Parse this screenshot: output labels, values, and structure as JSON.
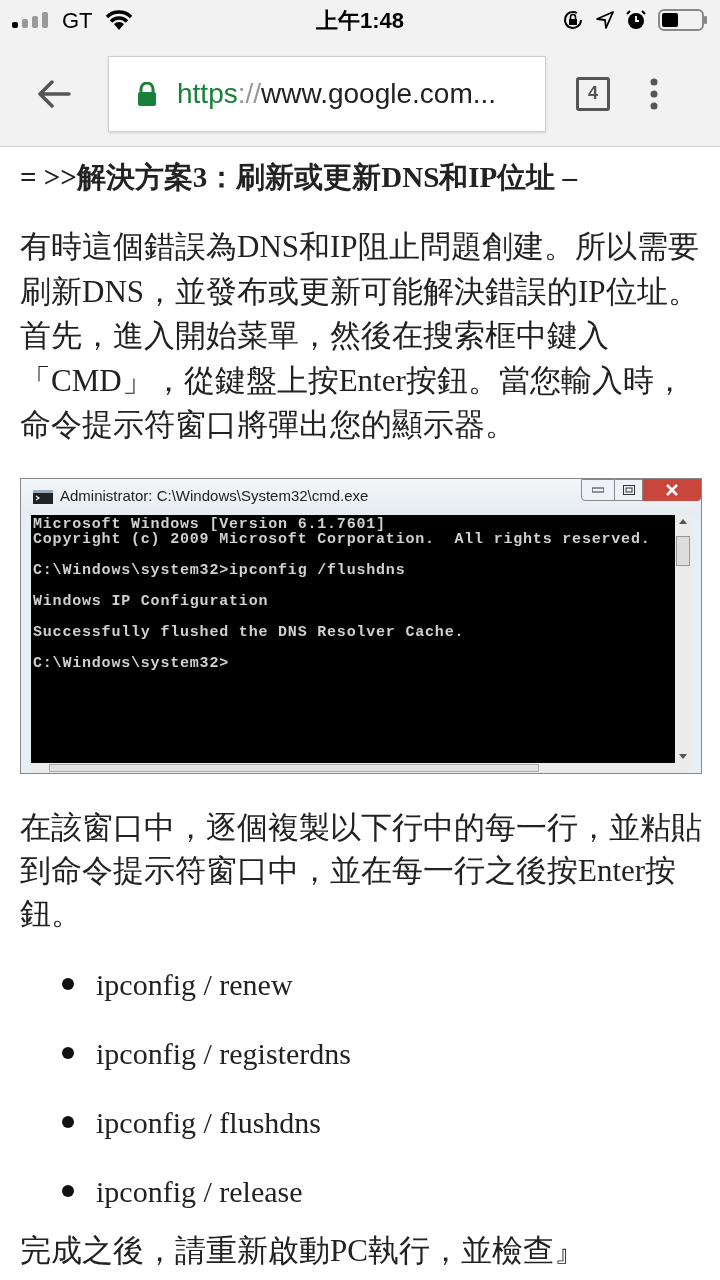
{
  "status_bar": {
    "carrier": "GT",
    "time": "上午1:48"
  },
  "browser": {
    "url_scheme": "https",
    "url_separator": "://",
    "url_rest": "www.google.com...",
    "tab_count": "4"
  },
  "article": {
    "heading": "= >>解決方案3：刷新或更新DNS和IP位址 –",
    "paragraph_1": "有時這個錯誤為DNS和IP阻止問題創建。所以需要刷新DNS，並發布或更新可能解決錯誤的IP位址。首先，進入開始菜單，然後在搜索框中鍵入「CMD」，從鍵盤上按Enter按鈕。當您輸入時，命令提示符窗口將彈出您的顯示器。",
    "cmd_window": {
      "title": "Administrator: C:\\Windows\\System32\\cmd.exe",
      "lines": [
        {
          "text": "Microsoft Windows [Version 6.1.7601]",
          "blank_before": false
        },
        {
          "text": "Copyright (c) 2009 Microsoft Corporation.  All rights reserved.",
          "blank_before": false
        },
        {
          "text": "C:\\Windows\\system32>ipconfig /flushdns",
          "blank_before": true
        },
        {
          "text": "Windows IP Configuration",
          "blank_before": true
        },
        {
          "text": "Successfully flushed the DNS Resolver Cache.",
          "blank_before": true
        },
        {
          "text": "C:\\Windows\\system32>",
          "blank_before": true
        }
      ]
    },
    "paragraph_2": "在該窗口中，逐個複製以下行中的每一行，並粘貼到命令提示符窗口中，並在每一行之後按Enter按鈕。",
    "commands": [
      "ipconfig / renew",
      "ipconfig / registerdns",
      "ipconfig / flushdns",
      "ipconfig / release"
    ],
    "paragraph_3": "完成之後，請重新啟動PC執行，並檢查』"
  }
}
